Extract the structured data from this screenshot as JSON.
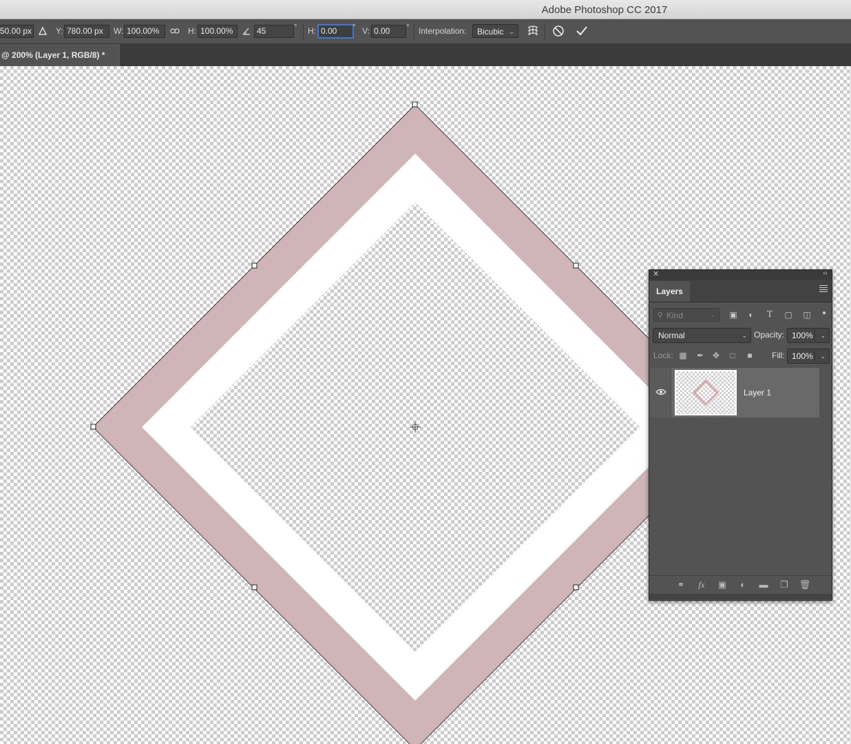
{
  "app": {
    "title": "Adobe Photoshop CC 2017"
  },
  "options_bar": {
    "x_value": "50.00 px",
    "y_label": "Y:",
    "y_value": "780.00 px",
    "w_label": "W:",
    "w_value": "100.00%",
    "h_label": "H:",
    "h_value": "100.00%",
    "angle_value": "45",
    "skew_h_label": "H:",
    "skew_h_value": "0.00",
    "skew_v_label": "V:",
    "skew_v_value": "0.00",
    "degree_symbol": "°",
    "interpolation_label": "Interpolation:",
    "interpolation_value": "Bicubic"
  },
  "document_tab": {
    "title": "@ 200% (Layer 1, RGB/8) *"
  },
  "canvas": {
    "shape_outer_color": "#cfb5b7",
    "shape_inner_color": "#ffffff"
  },
  "layers_panel": {
    "tab_label": "Layers",
    "filter_placeholder": "Kind",
    "blend_mode": "Normal",
    "opacity_label": "Opacity:",
    "opacity_value": "100%",
    "lock_label": "Lock:",
    "fill_label": "Fill:",
    "fill_value": "100%",
    "layers": [
      {
        "name": "Layer 1",
        "visible": true
      }
    ]
  }
}
